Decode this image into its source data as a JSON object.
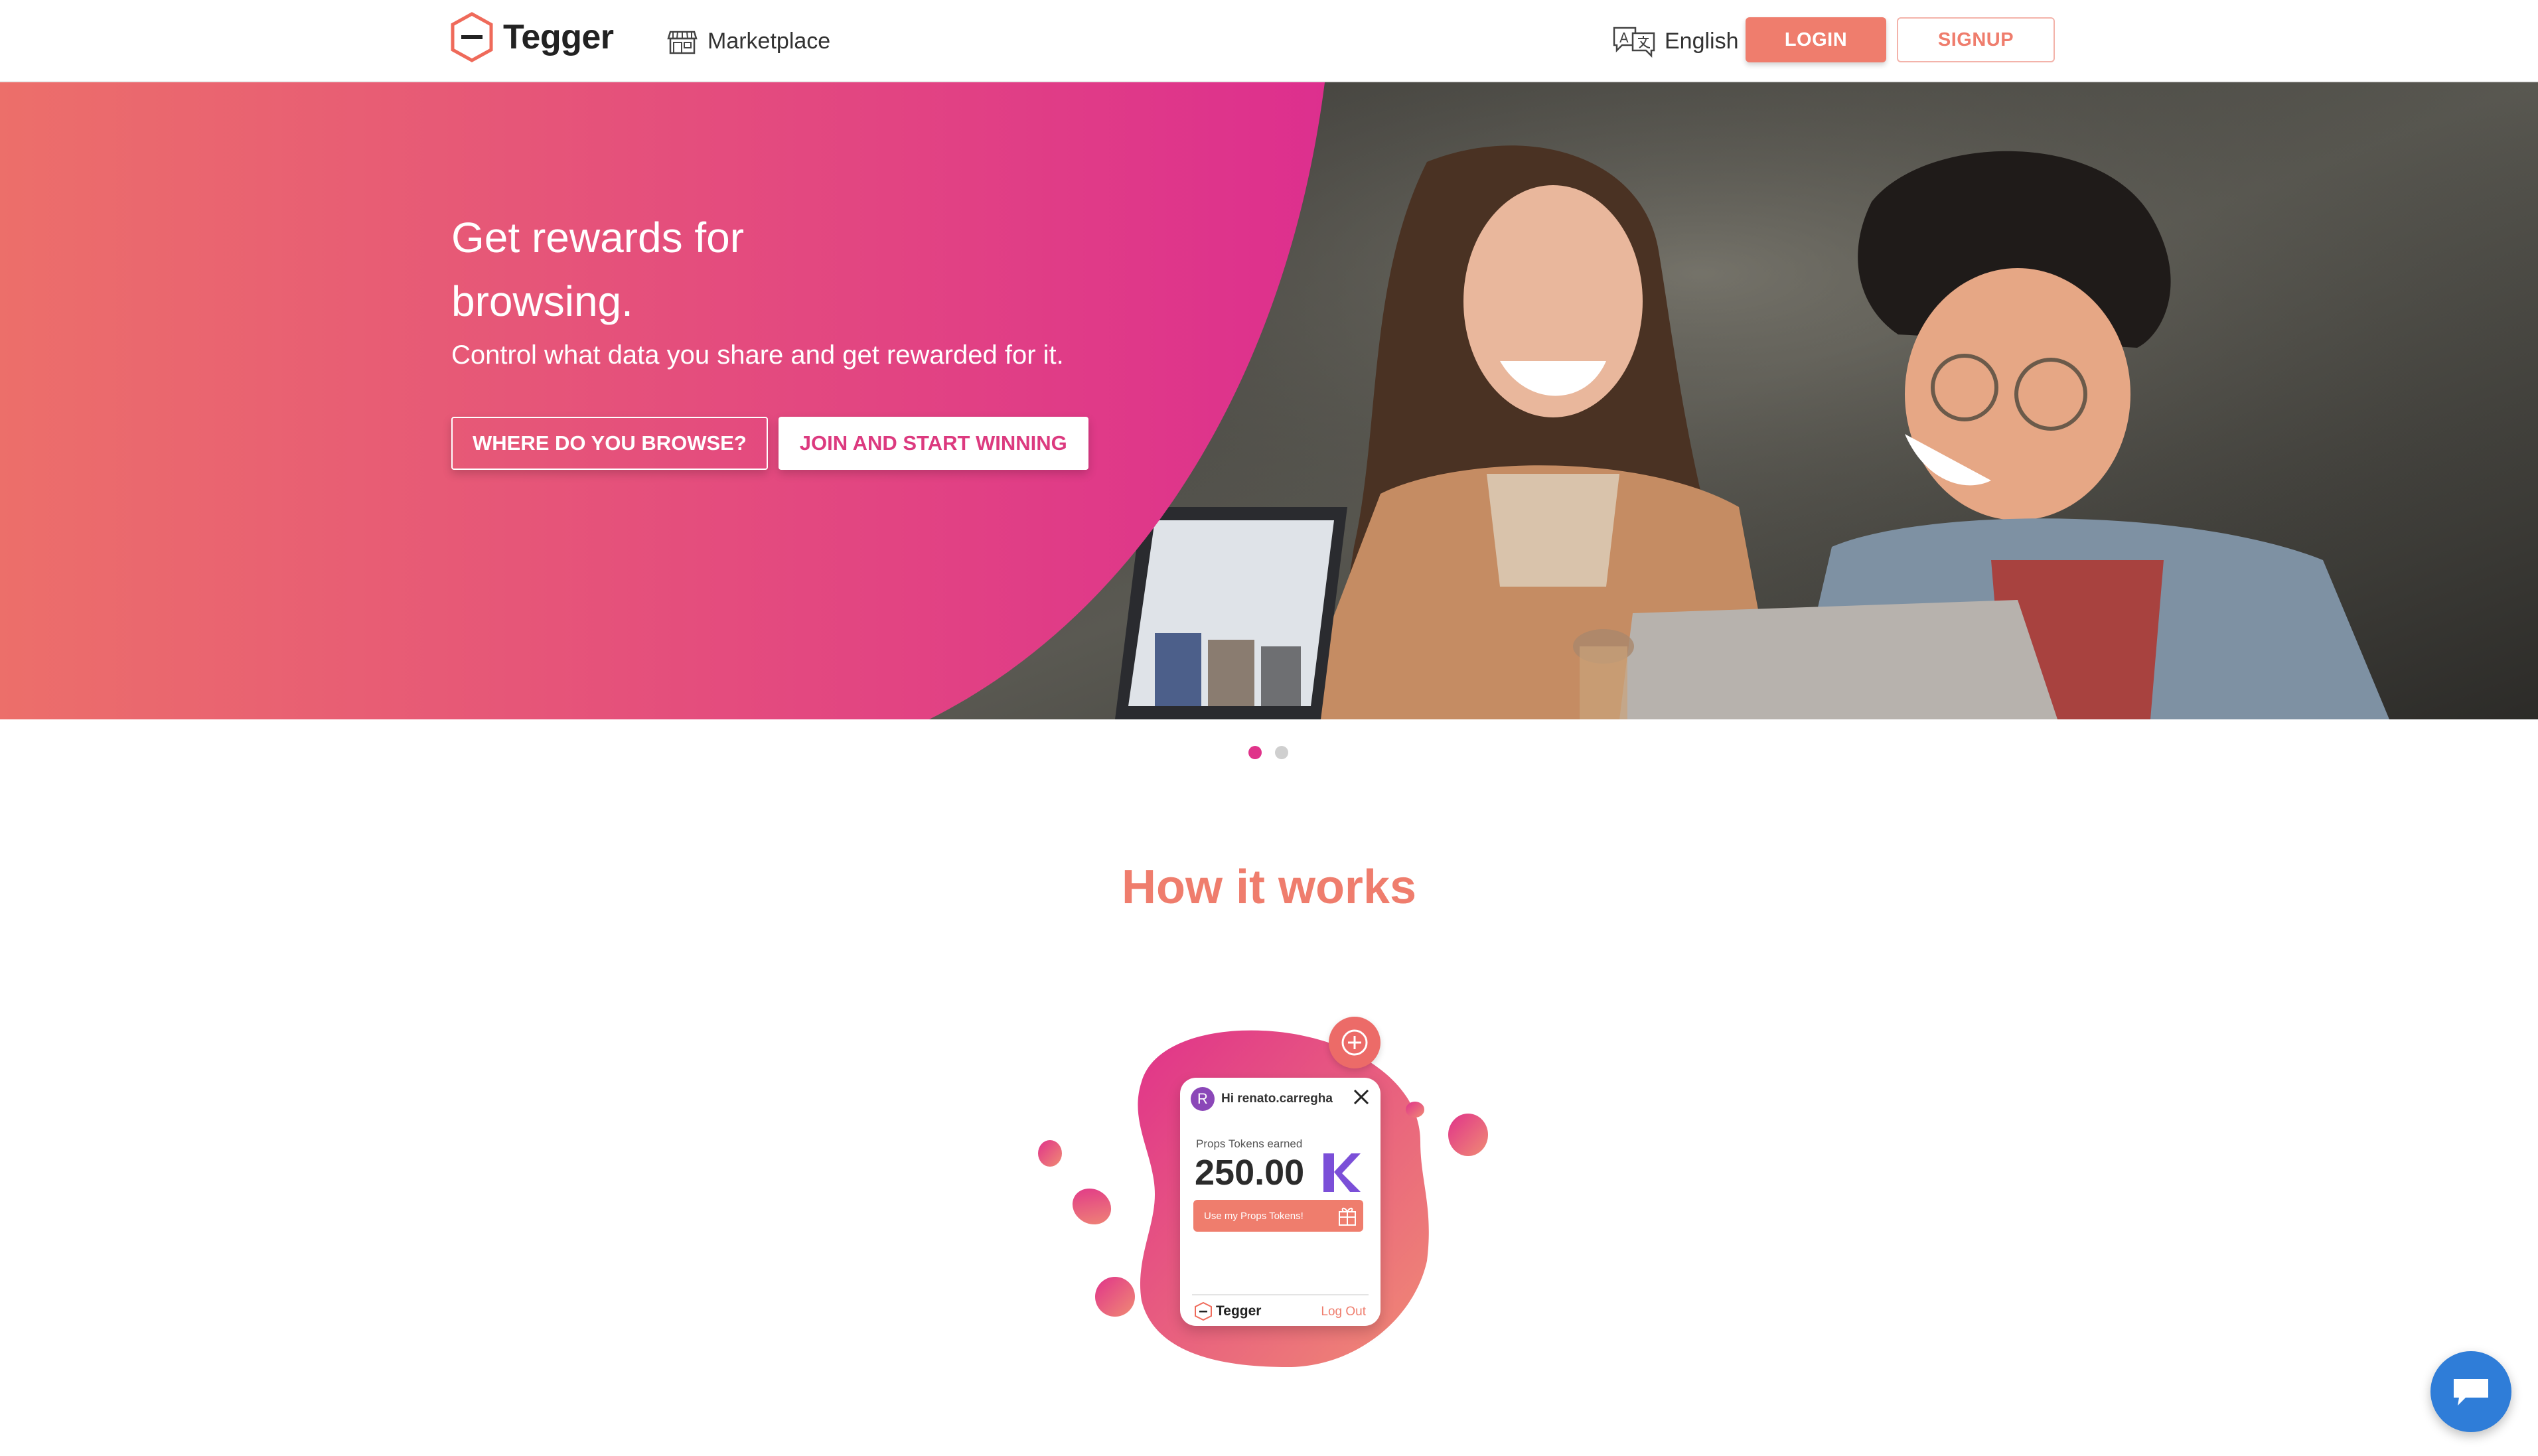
{
  "header": {
    "logo_text": "Tegger",
    "nav_marketplace": "Marketplace",
    "language": "English",
    "login_label": "LOGIN",
    "signup_label": "SIGNUP"
  },
  "hero": {
    "title": "Get rewards for browsing.",
    "subtitle": "Control what data you share and get rewarded for it.",
    "browse_button": "WHERE DO YOU BROWSE?",
    "join_button": "JOIN AND START WINNING"
  },
  "carousel": {
    "slide_count": 2,
    "active_index": 0
  },
  "how_it_works": {
    "title": "How it works",
    "popup": {
      "avatar_initial": "R",
      "greeting": "Hi renato.carregha",
      "tokens_label": "Props Tokens earned",
      "tokens_amount": "250.00",
      "use_tokens_button": "Use my Props Tokens!",
      "footer_logo": "Tegger",
      "logout": "Log Out"
    }
  },
  "colors": {
    "accent": "#ef7d6d",
    "hero_gradient_start": "#ec6f6a",
    "hero_gradient_end": "#dd2f8e",
    "dot_active": "#e0338a",
    "chat": "#2f7dd8",
    "avatar": "#8b47b8"
  },
  "icons": {
    "logo": "hexagon-logo-icon",
    "marketplace": "storefront-icon",
    "language": "translate-icon",
    "close": "close-icon",
    "plus": "plus-circle-icon",
    "props_token": "props-k-icon",
    "gift": "gift-icon",
    "chat": "chat-bubble-icon"
  }
}
